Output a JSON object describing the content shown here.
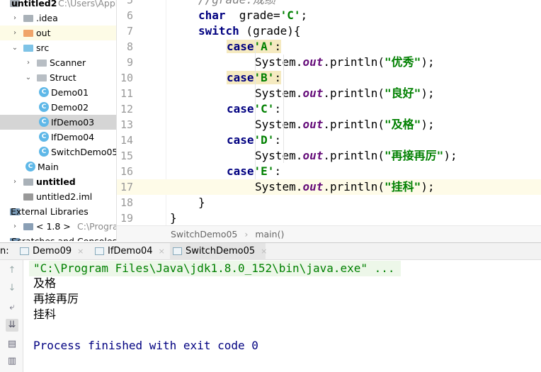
{
  "project_tree": [
    {
      "label": "untitled2",
      "hint": "C:\\Users\\Apple",
      "bold": true,
      "indent": 0,
      "arrow": "",
      "icon": "module-folder"
    },
    {
      "label": ".idea",
      "indent": 1,
      "arrow": "right",
      "icon": "folder-gray"
    },
    {
      "label": "out",
      "indent": 1,
      "arrow": "right",
      "icon": "folder-orange"
    },
    {
      "label": "src",
      "indent": 1,
      "arrow": "down",
      "icon": "folder-blue"
    },
    {
      "label": "Scanner",
      "indent": 2,
      "arrow": "right",
      "icon": "package"
    },
    {
      "label": "Struct",
      "indent": 2,
      "arrow": "down",
      "icon": "package"
    },
    {
      "label": "Demo01",
      "indent": 3,
      "icon": "class"
    },
    {
      "label": "Demo02",
      "indent": 3,
      "icon": "class"
    },
    {
      "label": "IfDemo03",
      "indent": 3,
      "icon": "class",
      "selected": true
    },
    {
      "label": "IfDemo04",
      "indent": 3,
      "icon": "class"
    },
    {
      "label": "SwitchDemo05",
      "indent": 3,
      "icon": "class"
    },
    {
      "label": "Main",
      "indent": 2,
      "icon": "class"
    },
    {
      "label": "untitled",
      "indent": 1,
      "arrow": "right",
      "icon": "module-folder",
      "bold": true
    },
    {
      "label": "untitled2.iml",
      "indent": 1,
      "icon": "iml-file"
    },
    {
      "label": "External Libraries",
      "indent": 0,
      "arrow": "",
      "icon": "libraries"
    },
    {
      "label": "< 1.8 >",
      "hint": "C:\\Program Fi",
      "indent": 1,
      "arrow": "right",
      "icon": "jdk"
    },
    {
      "label": "Scratches and Consoles",
      "indent": 0,
      "icon": "scratches"
    }
  ],
  "editor": {
    "lines": [
      {
        "n": "5",
        "indent": 2,
        "tokens": [
          [
            "cmt",
            "//grade:成绩"
          ]
        ]
      },
      {
        "n": "6",
        "indent": 2,
        "tokens": [
          [
            "kw",
            "char"
          ],
          [
            "",
            "  grade="
          ],
          [
            "str",
            "'C'"
          ],
          [
            "",
            ";"
          ]
        ]
      },
      {
        "n": "7",
        "indent": 2,
        "tokens": [
          [
            "kw",
            "switch"
          ],
          [
            "",
            " (grade){"
          ]
        ]
      },
      {
        "n": "8",
        "indent": 3,
        "tokens": [
          [
            "kw casehl",
            "case"
          ],
          [
            "str casehl",
            "'A'"
          ],
          [
            "casehl",
            ":"
          ]
        ]
      },
      {
        "n": "9",
        "indent": 4,
        "tokens": [
          [
            "",
            "System."
          ],
          [
            "field",
            "out"
          ],
          [
            "",
            ".println("
          ],
          [
            "str",
            "\"优秀\""
          ],
          [
            "",
            ");"
          ]
        ]
      },
      {
        "n": "10",
        "indent": 3,
        "tokens": [
          [
            "kw casehl",
            "case"
          ],
          [
            "str casehl",
            "'B'"
          ],
          [
            "casehl",
            ":"
          ]
        ]
      },
      {
        "n": "11",
        "indent": 4,
        "tokens": [
          [
            "",
            "System."
          ],
          [
            "field",
            "out"
          ],
          [
            "",
            ".println("
          ],
          [
            "str",
            "\"良好\""
          ],
          [
            "",
            ");"
          ]
        ]
      },
      {
        "n": "12",
        "indent": 3,
        "tokens": [
          [
            "kw",
            "case"
          ],
          [
            "str",
            "'C'"
          ],
          [
            "",
            ":"
          ]
        ]
      },
      {
        "n": "13",
        "indent": 4,
        "tokens": [
          [
            "",
            "System."
          ],
          [
            "field",
            "out"
          ],
          [
            "",
            ".println("
          ],
          [
            "str",
            "\"及格\""
          ],
          [
            "",
            ");"
          ]
        ]
      },
      {
        "n": "14",
        "indent": 3,
        "tokens": [
          [
            "kw",
            "case"
          ],
          [
            "str",
            "'D'"
          ],
          [
            "",
            ":"
          ]
        ]
      },
      {
        "n": "15",
        "indent": 4,
        "tokens": [
          [
            "",
            "System."
          ],
          [
            "field",
            "out"
          ],
          [
            "",
            ".println("
          ],
          [
            "str",
            "\"再接再厉\""
          ],
          [
            "",
            ");"
          ]
        ]
      },
      {
        "n": "16",
        "indent": 3,
        "tokens": [
          [
            "kw",
            "case"
          ],
          [
            "str",
            "'E'"
          ],
          [
            "",
            ":"
          ]
        ]
      },
      {
        "n": "17",
        "indent": 4,
        "current": true,
        "tokens": [
          [
            "",
            "System."
          ],
          [
            "field",
            "out"
          ],
          [
            "",
            ".println("
          ],
          [
            "str",
            "\"挂科\""
          ],
          [
            "",
            ");"
          ]
        ]
      },
      {
        "n": "18",
        "indent": 2,
        "tokens": [
          [
            "",
            "}"
          ]
        ]
      },
      {
        "n": "19",
        "indent": 1,
        "tokens": [
          [
            "",
            "}"
          ]
        ]
      }
    ]
  },
  "breadcrumb": {
    "class": "SwitchDemo05",
    "sep": "›",
    "method": "main()"
  },
  "run": {
    "label": "n:",
    "tabs": [
      {
        "label": "Demo09"
      },
      {
        "label": "IfDemo04"
      },
      {
        "label": "SwitchDemo05",
        "active": true
      }
    ],
    "close": "×"
  },
  "console": {
    "command": "\"C:\\Program Files\\Java\\jdk1.8.0_152\\bin\\java.exe\" ...",
    "output": [
      "及格",
      "再接再厉",
      "挂科"
    ],
    "exit": "Process finished with exit code 0"
  },
  "colors": {
    "keyword": "#000080",
    "string": "#008000",
    "field": "#660e7a",
    "current_line": "#fefbe8",
    "selection": "#d5d5d5"
  }
}
